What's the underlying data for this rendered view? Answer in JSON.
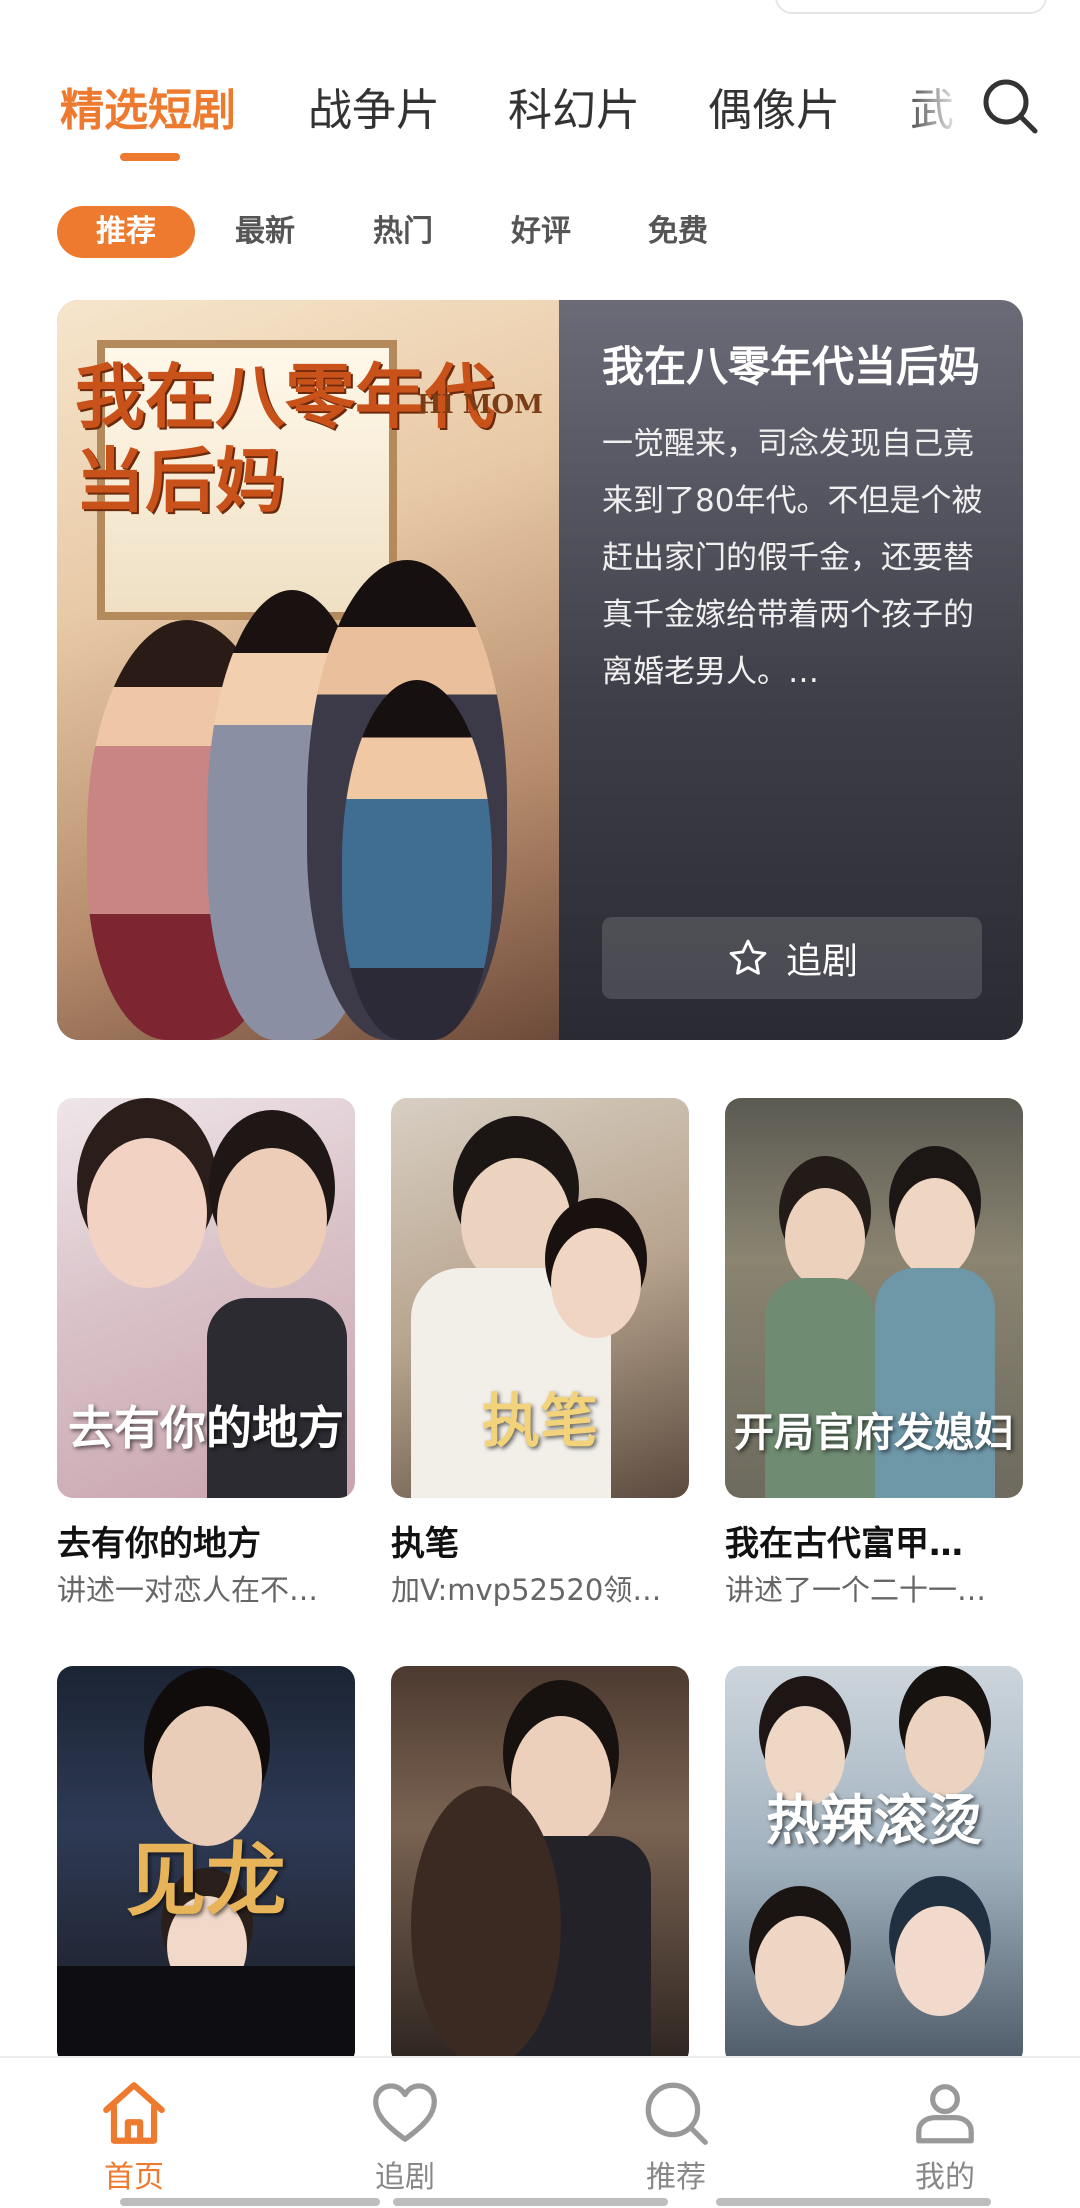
{
  "category_tabs": [
    "精选短剧",
    "战争片",
    "科幻片",
    "偶像片",
    "武"
  ],
  "active_category": "精选短剧",
  "filter_chips": [
    "推荐",
    "最新",
    "热门",
    "好评",
    "免费"
  ],
  "active_chip": "推荐",
  "featured": {
    "poster_title": "我在八零年代当后妈",
    "poster_subtitle": "HI MOM",
    "title": "我在八零年代当后妈",
    "description": "一觉醒来，司念发现自己竟来到了80年代。不但是个被赶出家门的假千金，还要替真千金嫁给带着两个孩子的离婚老男人。…",
    "follow_label": "追剧"
  },
  "grid": [
    {
      "title": "去有你的地方",
      "subtitle": "讲述一对恋人在不…",
      "art": "去有你的地方"
    },
    {
      "title": "执笔",
      "subtitle": "加V:mvp52520领…",
      "art": "执笔"
    },
    {
      "title": "我在古代富甲…",
      "subtitle": "讲述了一个二十一…",
      "art": "开局官府发媳妇"
    },
    {
      "title": "",
      "subtitle": "",
      "art": "见龙"
    },
    {
      "title": "",
      "subtitle": "",
      "art": ""
    },
    {
      "title": "",
      "subtitle": "",
      "art": "热辣滚烫"
    }
  ],
  "bottom_nav": [
    {
      "label": "首页",
      "icon": "home-icon"
    },
    {
      "label": "追剧",
      "icon": "heart-icon"
    },
    {
      "label": "推荐",
      "icon": "search-icon"
    },
    {
      "label": "我的",
      "icon": "profile-icon"
    }
  ],
  "colors": {
    "accent": "#ee7a2f",
    "inactive": "#888888"
  }
}
